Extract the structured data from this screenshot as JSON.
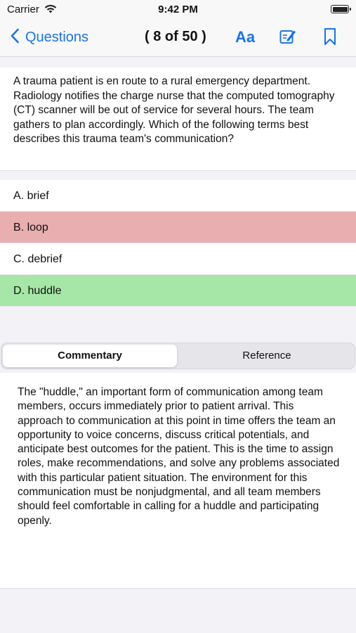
{
  "status_bar": {
    "carrier": "Carrier",
    "time": "9:42 PM"
  },
  "nav": {
    "back_label": "Questions",
    "counter": "( 8 of 50 )",
    "font_button": "Aa",
    "accent_color": "#1a73e8"
  },
  "question": {
    "text": "A trauma patient is en route to a rural emergency department. Radiology notifies the charge nurse that the computed tomography (CT) scanner will be out of service for several hours. The team gathers to plan accordingly. Which of the following terms best describes this trauma team's communication?"
  },
  "answers": [
    {
      "label": "A. brief",
      "state": "neutral"
    },
    {
      "label": "B. loop",
      "state": "incorrect"
    },
    {
      "label": "C. debrief",
      "state": "neutral"
    },
    {
      "label": "D. huddle",
      "state": "correct"
    }
  ],
  "tabs": {
    "commentary": "Commentary",
    "reference": "Reference",
    "selected": "Commentary"
  },
  "commentary": {
    "text": "The \"huddle,\" an important form of communication among team members, occurs immediately prior to patient arrival. This approach to communication at this point in time offers the team an opportunity to voice concerns, discuss critical potentials, and anticipate best outcomes for the patient. This is the time to assign roles, make recommendations, and solve any problems associated with this particular patient situation. The environment for this communication must be nonjudgmental, and all team members should feel comfortable in calling for a huddle and participating openly."
  },
  "icons": {
    "wifi": "wifi-icon",
    "battery": "battery-icon",
    "back": "chevron-left-icon",
    "edit": "edit-note-icon",
    "bookmark": "bookmark-icon"
  },
  "colors": {
    "incorrect": "#e8aeb0",
    "correct": "#a6e6a6"
  }
}
